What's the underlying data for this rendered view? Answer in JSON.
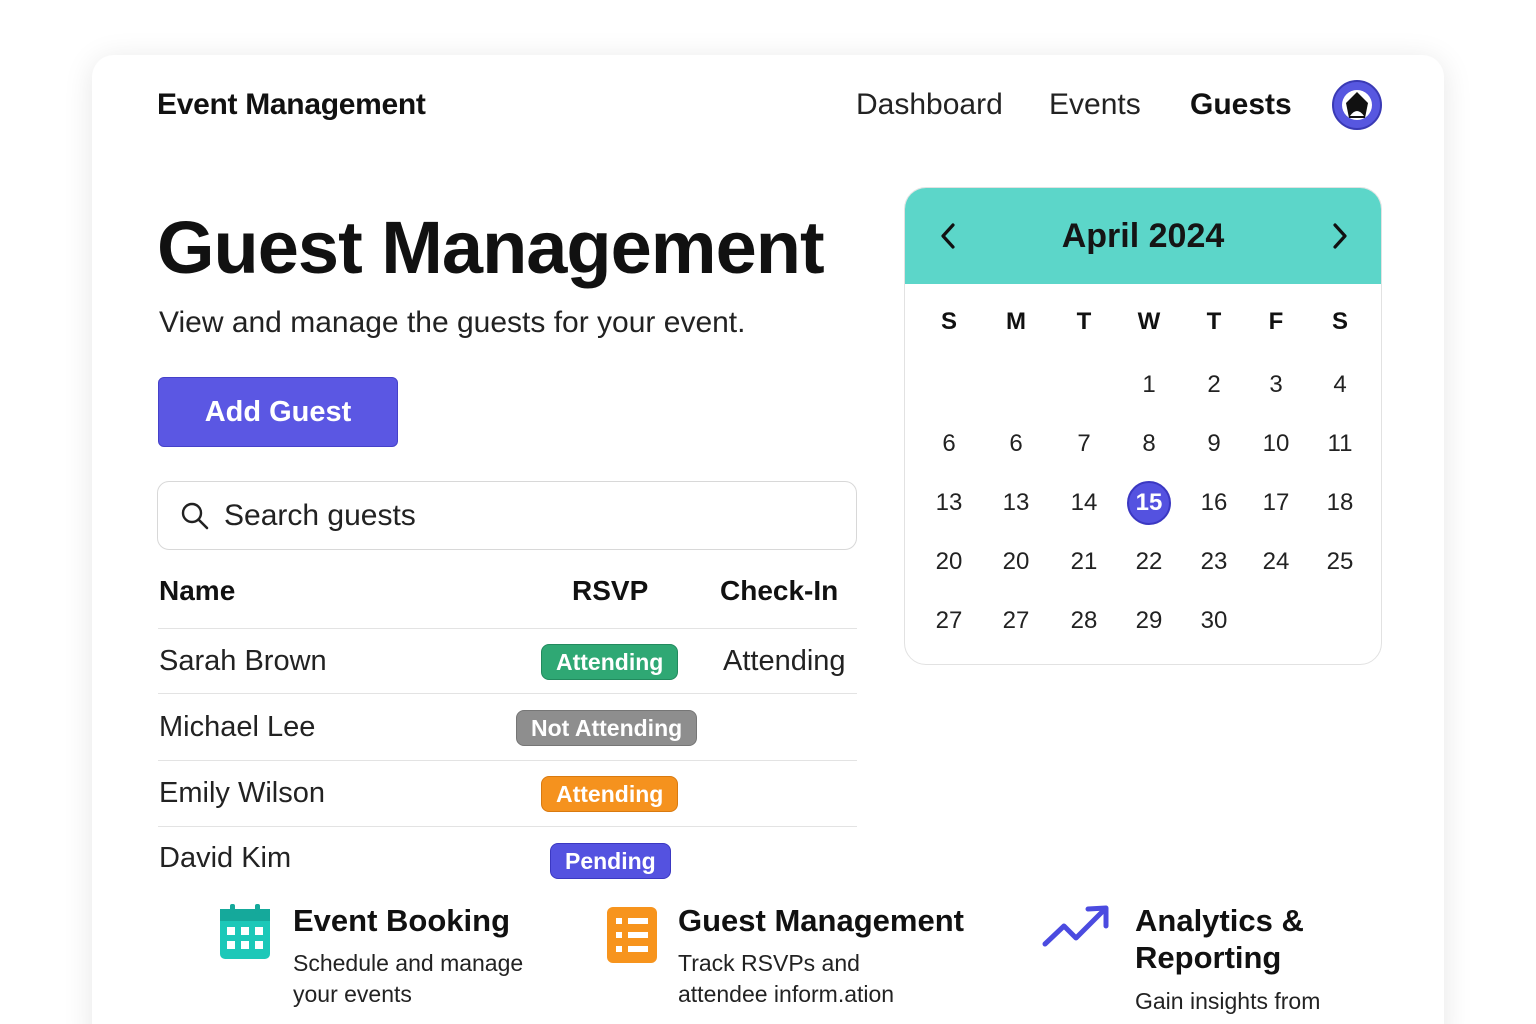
{
  "header": {
    "brand": "Event Management",
    "nav": [
      {
        "label": "Dashboard",
        "active": false
      },
      {
        "label": "Events",
        "active": false
      },
      {
        "label": "Guests",
        "active": true
      }
    ],
    "avatar_icon": "user-avatar-icon"
  },
  "main": {
    "title": "Guest Management",
    "subtitle": "View and manage the guests for your event.",
    "add_button": "Add Guest",
    "search": {
      "placeholder": "Search guests",
      "value": ""
    },
    "table": {
      "columns": [
        "Name",
        "RSVP",
        "Check-In"
      ],
      "rows": [
        {
          "name": "Sarah Brown",
          "rsvp": "Attending",
          "rsvp_color": "#2fa874",
          "checkin": "Attending"
        },
        {
          "name": "Michael Lee",
          "rsvp": "Not Attending",
          "rsvp_color": "#8e8e8e",
          "checkin": ""
        },
        {
          "name": "Emily Wilson",
          "rsvp": "Attending",
          "rsvp_color": "#f5921e",
          "checkin": ""
        },
        {
          "name": "David Kim",
          "rsvp": "Pending",
          "rsvp_color": "#5452e0",
          "checkin": ""
        }
      ]
    }
  },
  "calendar": {
    "month": "April 2024",
    "prev_icon": "chevron-left-icon",
    "next_icon": "chevron-right-icon",
    "weekdays": [
      "S",
      "M",
      "T",
      "W",
      "T",
      "F",
      "S"
    ],
    "weeks": [
      [
        "",
        "",
        "",
        "1",
        "2",
        "3",
        "4"
      ],
      [
        "6",
        "6",
        "7",
        "8",
        "9",
        "10",
        "11"
      ],
      [
        "13",
        "13",
        "14",
        "15",
        "16",
        "17",
        "18"
      ],
      [
        "20",
        "20",
        "21",
        "22",
        "23",
        "24",
        "25"
      ],
      [
        "27",
        "27",
        "28",
        "29",
        "30",
        "",
        ""
      ]
    ],
    "selected_day": "15",
    "header_color": "#5cd6c9",
    "accent_color": "#5452e0"
  },
  "features": [
    {
      "icon": "calendar-icon",
      "title": "Event Booking",
      "desc_lines": [
        "Schedule and manage",
        "your events"
      ]
    },
    {
      "icon": "list-icon",
      "title": "Guest Management",
      "desc_lines": [
        "Track RSVPs and",
        "attendee inform.ation"
      ]
    },
    {
      "icon": "trending-up-icon",
      "title_lines": [
        "Analytics &",
        "Reporting"
      ],
      "desc_lines": [
        "Gain insights from"
      ]
    }
  ]
}
